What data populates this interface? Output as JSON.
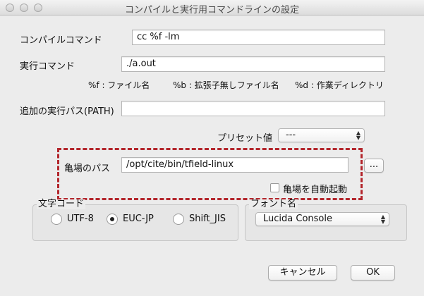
{
  "window": {
    "title": "コンパイルと実行用コマンドラインの設定"
  },
  "compile": {
    "label": "コンパイルコマンド",
    "value": "cc %f -lm"
  },
  "run": {
    "label": "実行コマンド",
    "value": "./a.out"
  },
  "hints": {
    "f": "%f : ファイル名",
    "b": "%b : 拡張子無しファイル名",
    "d": "%d : 作業ディレクトリ"
  },
  "path": {
    "label": "追加の実行パス(PATH)",
    "value": ""
  },
  "preset": {
    "label": "プリセット値",
    "selected": "---"
  },
  "kame": {
    "label": "亀場のパス",
    "value": "/opt/cite/bin/tfield-linux",
    "browse_label": "...",
    "autostart_label": "亀場を自動起動"
  },
  "encoding": {
    "title": "文字コード",
    "options": [
      "UTF-8",
      "EUC-JP",
      "Shift_JIS"
    ],
    "selected": "EUC-JP"
  },
  "font": {
    "title": "フォント名",
    "selected": "Lucida Console"
  },
  "buttons": {
    "cancel": "キャンセル",
    "ok": "OK"
  },
  "colors": {
    "highlight_border": "#b3262c"
  }
}
